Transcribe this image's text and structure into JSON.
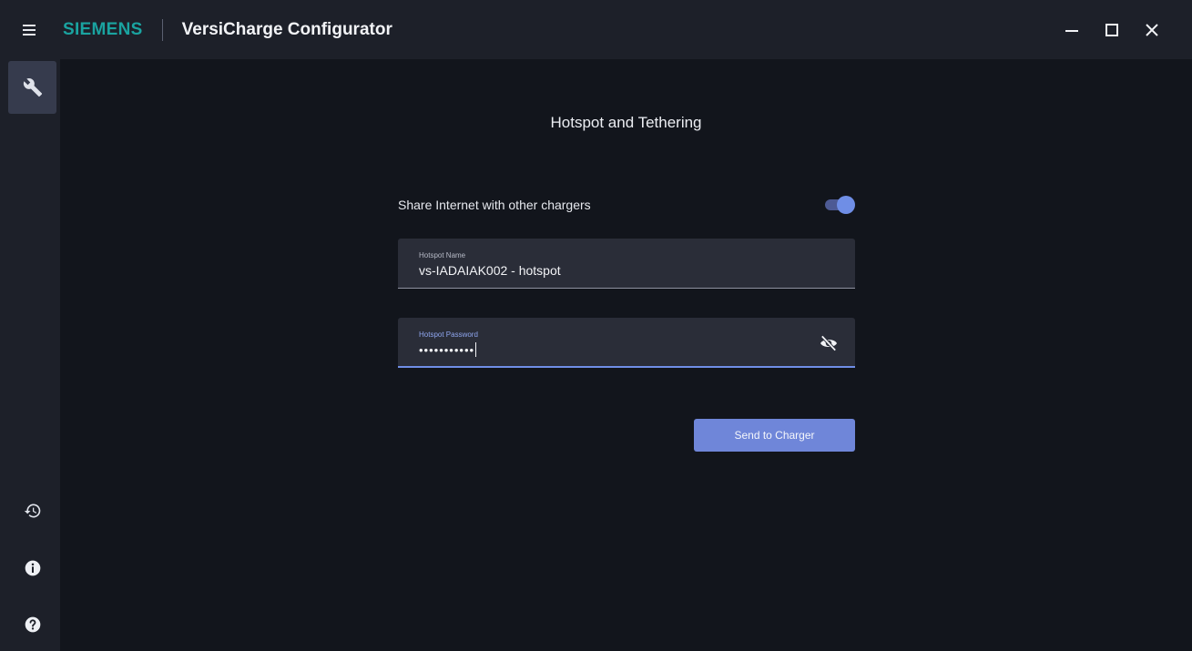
{
  "header": {
    "brand": "SIEMENS",
    "app_title": "VersiCharge Configurator",
    "brand_color": "#1aa3a0"
  },
  "window_controls": {
    "minimize_icon": "minimize-icon",
    "maximize_icon": "maximize-icon",
    "close_icon": "close-icon"
  },
  "sidebar": {
    "top_items": [
      {
        "icon": "wrench-icon",
        "active": true
      }
    ],
    "bottom_items": [
      {
        "icon": "history-icon"
      },
      {
        "icon": "info-icon"
      },
      {
        "icon": "help-icon"
      }
    ]
  },
  "main": {
    "section_title": "Hotspot and Tethering",
    "share_internet": {
      "label": "Share Internet with other chargers",
      "enabled": true
    },
    "hotspot_name": {
      "label": "Hotspot Name",
      "value": "vs-IADAIAK002 - hotspot"
    },
    "hotspot_password": {
      "label": "Hotspot Password",
      "value": "•••••••••••",
      "visibility_icon": "eye-off-icon"
    },
    "send_button": "Send to Charger"
  },
  "colors": {
    "accent": "#6f86d9",
    "background": "#12151c",
    "panel": "#1d2029"
  }
}
